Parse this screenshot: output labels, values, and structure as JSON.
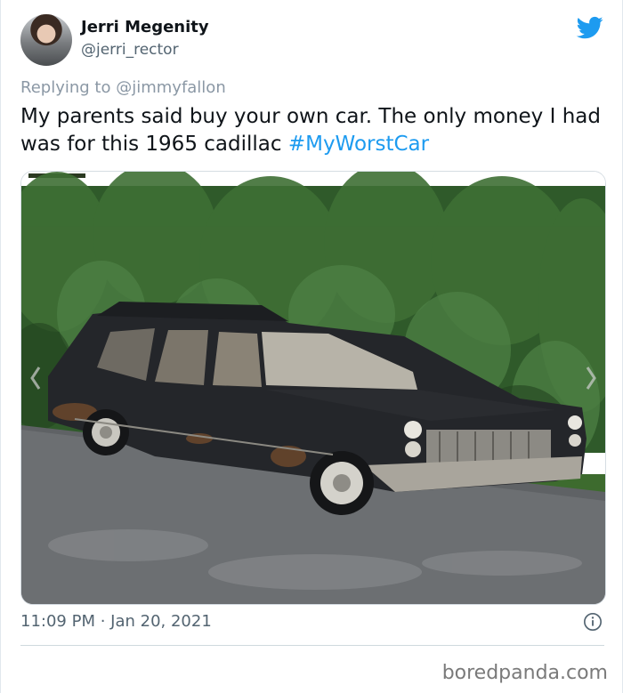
{
  "tweet": {
    "author_name": "Jerri Megenity",
    "author_handle": "@jerri_rector",
    "replying_prefix": "Replying to",
    "replying_to": "@jimmyfallon",
    "text": "My parents said buy your own car. The only money I had was for this 1965 cadillac",
    "hashtag": "#MyWorstCar",
    "timestamp": "11:09 PM · Jan 20, 2021"
  },
  "media": {
    "description_icon": "photo-of-1965-cadillac-hearse"
  },
  "icons": {
    "brand": "twitter-bird-icon",
    "info": "info-icon"
  },
  "watermark": "boredpanda.com",
  "colors": {
    "link_blue": "#1d9bf0",
    "muted_gray": "#536471",
    "text": "#0f1419"
  }
}
